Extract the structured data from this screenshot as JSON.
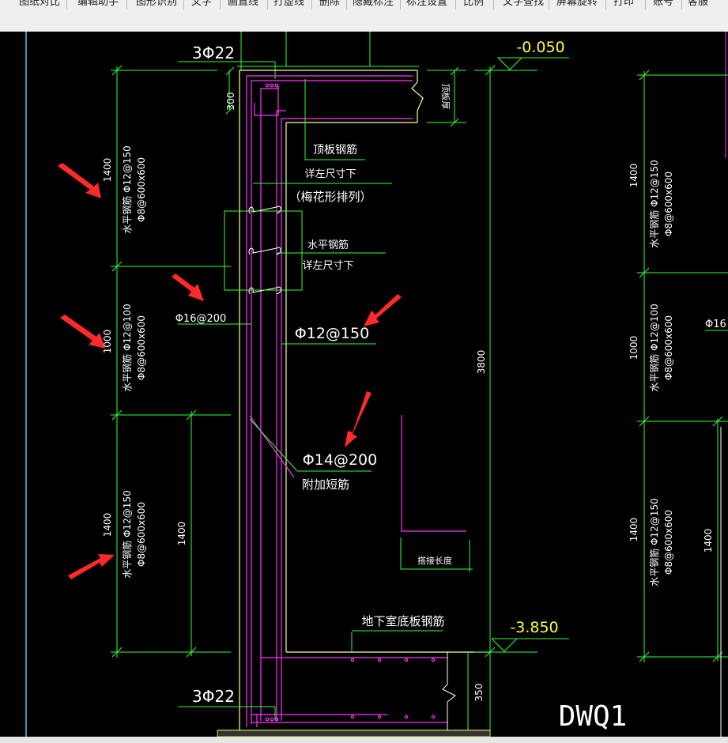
{
  "toolbar": {
    "items": [
      "图纸对比",
      "编辑助手",
      "图形识别",
      "文字",
      "画直线",
      "打虚线",
      "删除",
      "隐藏标注",
      "标注设置",
      "比例",
      "文字查找",
      "屏幕旋转",
      "打印",
      "账号",
      "客服"
    ]
  },
  "drawing": {
    "colors": {
      "background": "#000000",
      "wall": "#ffff99",
      "rebar": "#ff33ff",
      "dimension": "#33ff33",
      "text": "#ffffff",
      "elevation": "#ffff33",
      "arrow": "#ff2a2a"
    },
    "elev_top": "-0.050",
    "elev_bottom": "-3.850",
    "top_bars": "3Φ22",
    "bottom_bars": "3Φ22",
    "dim_300": "300",
    "dim_350": "350",
    "dim_3800": "3800",
    "roof_slab_thickness": "顶板厚",
    "roof_slab_rebar": "顶板钢筋",
    "see_size_1": "详左尺寸下",
    "plum_pattern": "（梅花形排列）",
    "horizontal_rebar": "水平钢筋",
    "see_size_2": "详左尺寸下",
    "d16": "Φ16@200",
    "d12": "Φ12@150",
    "d14": "Φ14@200",
    "extra_short_bar": "附加短筋",
    "lap_length": "搭接长度",
    "basement_slab_rebar": "地下室底板钢筋",
    "wall_id": "DWQ1",
    "left_zones": [
      {
        "dim": "1400",
        "label": "水平钢筋 Φ12@150",
        "tie": "Φ8@600x600"
      },
      {
        "dim": "1000",
        "label": "水平钢筋 Φ12@100",
        "tie": "Φ8@600x600"
      },
      {
        "dim": "1400",
        "label": "水平钢筋 Φ12@150",
        "tie": "Φ8@600x600"
      }
    ],
    "inner_dim": "1400",
    "right_zones": [
      {
        "dim": "1400",
        "label": "水平钢筋 Φ12@150",
        "tie": "Φ8@600x600"
      },
      {
        "dim": "1000",
        "label": "水平钢筋 Φ12@100",
        "tie": "Φ8@600x600"
      },
      {
        "dim": "1400",
        "label": "水平钢筋 Φ12@150",
        "tie": "Φ8@600x600"
      }
    ],
    "right_inner_dim": "1400",
    "right_partial": "Φ16"
  }
}
